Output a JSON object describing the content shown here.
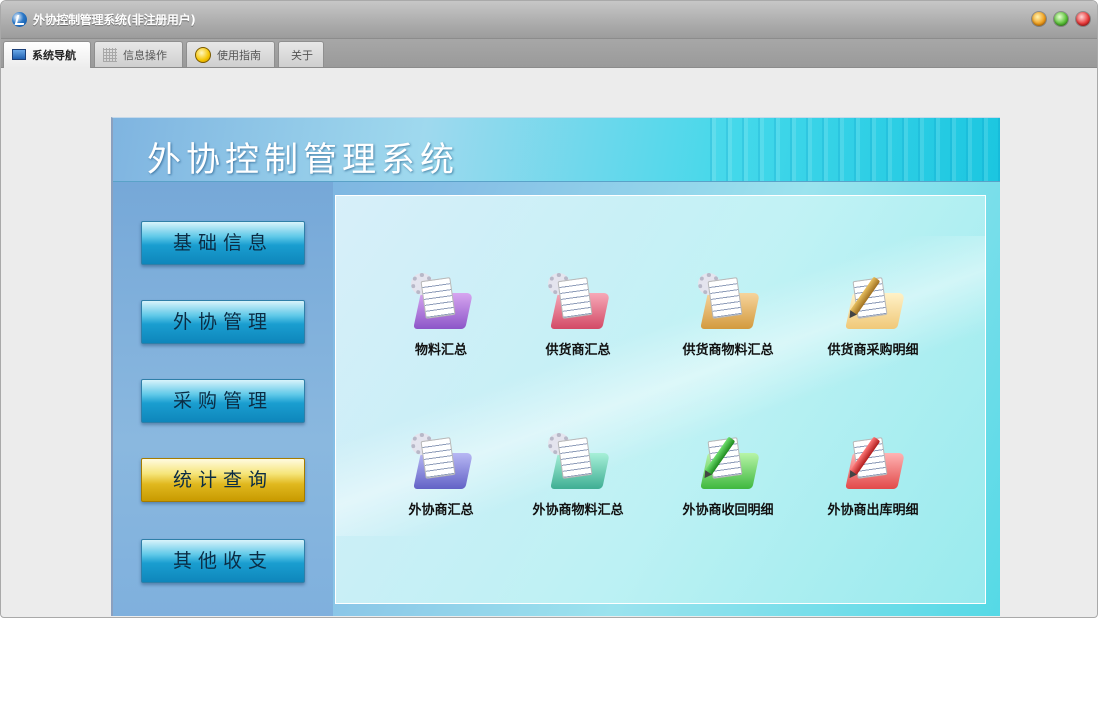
{
  "window": {
    "title": "外协控制管理系统(非注册用户)",
    "controls": [
      "minimize",
      "maximize",
      "close"
    ]
  },
  "tabs": [
    {
      "label": "系统导航",
      "icon": "monitor-icon",
      "active": true
    },
    {
      "label": "信息操作",
      "icon": "grid-icon",
      "active": false
    },
    {
      "label": "使用指南",
      "icon": "lightbulb-icon",
      "active": false
    },
    {
      "label": "关于",
      "icon": "",
      "active": false
    }
  ],
  "panel": {
    "system_title": "外协控制管理系统",
    "sidebar": [
      {
        "label": "基础信息",
        "active": false
      },
      {
        "label": "外协管理",
        "active": false
      },
      {
        "label": "采购管理",
        "active": false
      },
      {
        "label": "统计查询",
        "active": true
      },
      {
        "label": "其他收支",
        "active": false
      }
    ],
    "items": [
      {
        "label": "物料汇总",
        "icon": "purple-folder-report-icon",
        "color": "#9b63d2"
      },
      {
        "label": "供货商汇总",
        "icon": "pink-folder-report-icon",
        "color": "#d84f6c"
      },
      {
        "label": "供货商物料汇总",
        "icon": "tan-folder-report-icon",
        "color": "#d9a04a"
      },
      {
        "label": "供货商采购明细",
        "icon": "pencil-document-icon",
        "color": "#c89a3a"
      },
      {
        "label": "外协商汇总",
        "icon": "blue-folder-report-icon",
        "color": "#6a6ac8"
      },
      {
        "label": "外协商物料汇总",
        "icon": "teal-folder-report-icon",
        "color": "#45b398"
      },
      {
        "label": "外协商收回明细",
        "icon": "green-pencil-document-icon",
        "color": "#3fb83f"
      },
      {
        "label": "外协商出库明细",
        "icon": "red-pencil-document-icon",
        "color": "#e24a4a"
      }
    ]
  }
}
